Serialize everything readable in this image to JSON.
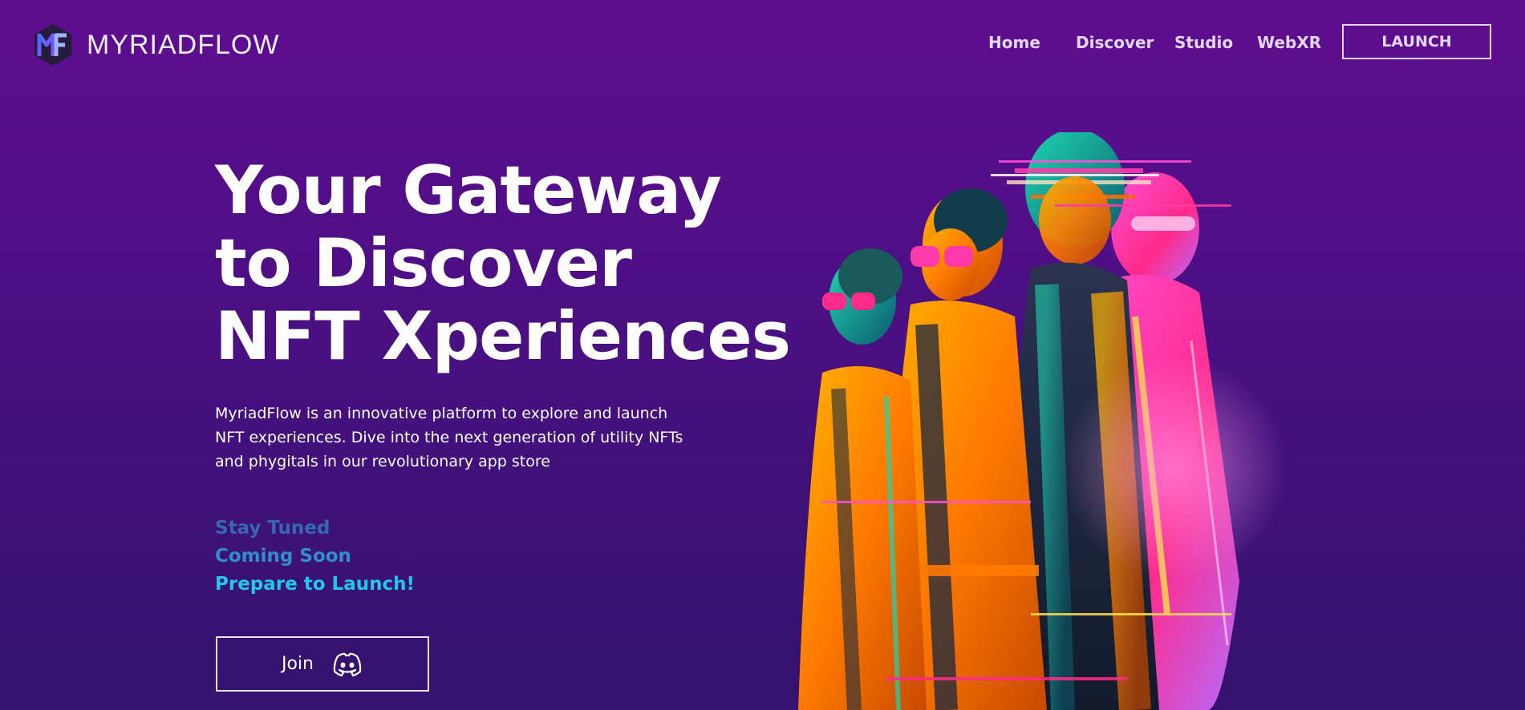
{
  "brand": {
    "name": "MYRIADFLOW",
    "logo_icon": "myriadflow-logo-icon"
  },
  "nav": {
    "items": [
      {
        "label": "Home"
      },
      {
        "label": "Discover"
      },
      {
        "label": "Studio"
      },
      {
        "label": "WebXR"
      }
    ],
    "launch_label": "LAUNCH"
  },
  "hero": {
    "title_lines": [
      "Your Gateway",
      "to Discover",
      "NFT Xperiences"
    ],
    "description_lines": [
      "MyriadFlow is an innovative platform to explore and launch",
      "NFT experiences. Dive into the next generation of utility NFTs",
      "and phygitals in our revolutionary app store"
    ],
    "status": [
      {
        "label": "Stay Tuned",
        "color": "#3468b3"
      },
      {
        "label": "Coming Soon",
        "color": "#2f8fcc"
      },
      {
        "label": "Prepare to Launch!",
        "color": "#22c8ea"
      }
    ],
    "join_label": "Join",
    "join_icon": "discord-icon",
    "art_description_icon": "hero-illustration"
  },
  "colors": {
    "background_top": "#5f0d8f",
    "background_bottom": "#33136d",
    "nav_text": "#e3d7ff",
    "accent_cyan": "#22c8ea"
  }
}
